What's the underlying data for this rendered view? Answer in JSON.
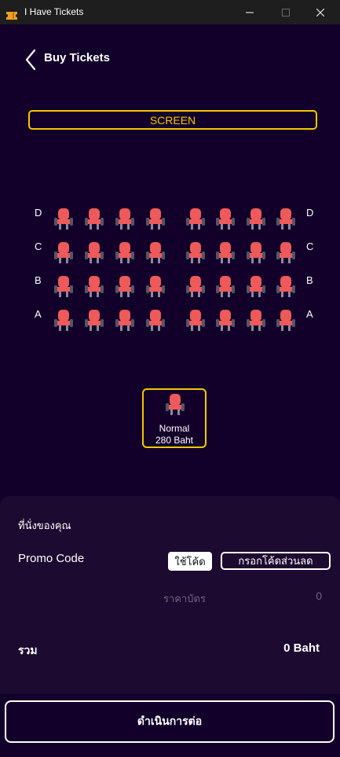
{
  "window": {
    "title": "I Have Tickets",
    "app_icon": "ticket-icon",
    "buttons": [
      "minimize-icon",
      "maximize-icon",
      "close-icon"
    ]
  },
  "header": {
    "back_icon": "chevron-left-icon",
    "title": "Buy Tickets"
  },
  "screen_label": "SCREEN",
  "seat_map": {
    "rows": [
      "D",
      "C",
      "B",
      "A"
    ],
    "seats_per_side": 4,
    "seat_icon": "seat-icon",
    "seat_color": "#ee5a5a"
  },
  "legend": [
    {
      "name": "Normal",
      "price": "280 Baht"
    }
  ],
  "summary": {
    "your_seats_label": "ที่นั่งของคุณ",
    "promo_label": "Promo Code",
    "use_code_label": "ใช้โค้ด",
    "promo_placeholder": "กรอกโค้ดส่วนลด",
    "ticket_price_label": "ราคาบัตร",
    "ticket_price_value": "0",
    "total_label": "รวม",
    "total_value": "0 Baht"
  },
  "continue_label": "ดำเนินการต่อ",
  "colors": {
    "background": "#13002a",
    "accent": "#f5c800",
    "panel": "#1d0a30",
    "muted_text": "#6e6480"
  }
}
